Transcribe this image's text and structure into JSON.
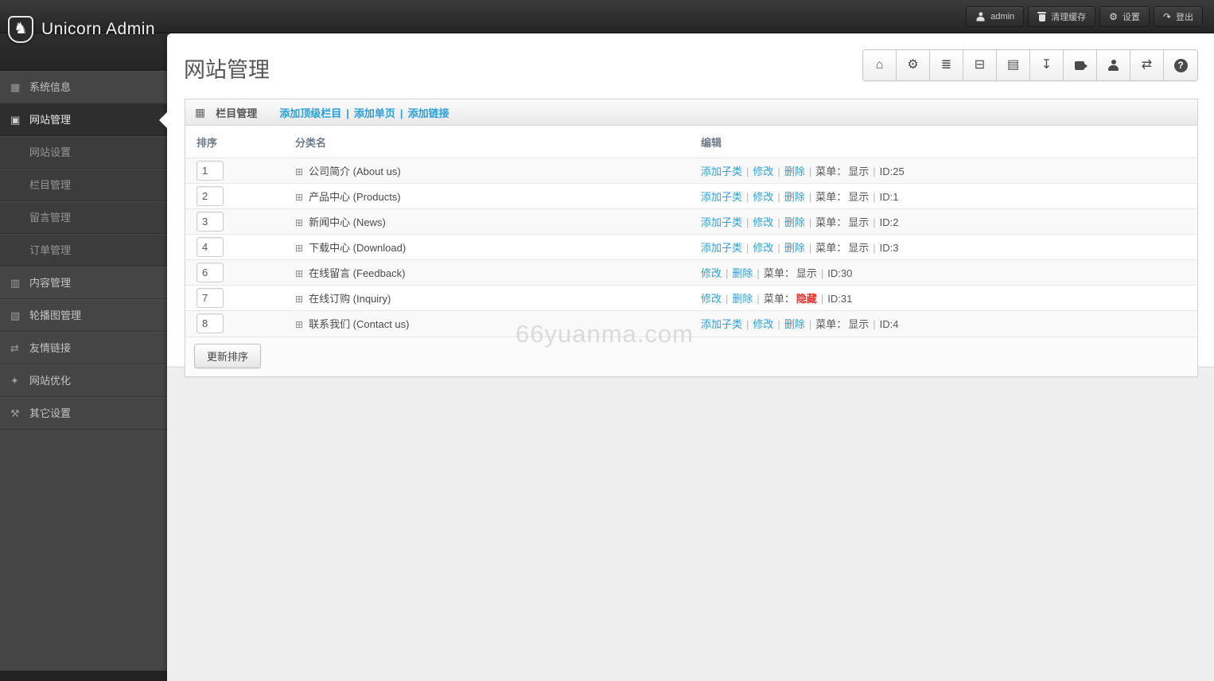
{
  "topbar": {
    "brand": "Unicorn Admin",
    "buttons": [
      {
        "icon": "person",
        "label": "admin"
      },
      {
        "icon": "trash",
        "label": "清理缓存"
      },
      {
        "icon": "gear",
        "label": "设置"
      },
      {
        "icon": "logout",
        "label": "登出"
      }
    ]
  },
  "sidebar": {
    "items": [
      {
        "icon": "grid",
        "label": "系统信息",
        "type": "item"
      },
      {
        "icon": "file",
        "label": "网站管理",
        "type": "active"
      },
      {
        "icon": null,
        "label": "网站设置",
        "type": "sub"
      },
      {
        "icon": null,
        "label": "栏目管理",
        "type": "sub"
      },
      {
        "icon": null,
        "label": "留言管理",
        "type": "sub"
      },
      {
        "icon": null,
        "label": "订单管理",
        "type": "sub"
      },
      {
        "icon": "briefcase",
        "label": "内容管理",
        "type": "item"
      },
      {
        "icon": "picture",
        "label": "轮播图管理",
        "type": "item"
      },
      {
        "icon": "retweet",
        "label": "友情链接",
        "type": "item"
      },
      {
        "icon": "magic",
        "label": "网站优化",
        "type": "item"
      },
      {
        "icon": "wrench",
        "label": "其它设置",
        "type": "item"
      }
    ]
  },
  "page": {
    "title": "网站管理"
  },
  "quick_actions": [
    "home",
    "gear",
    "list",
    "hdd",
    "book",
    "download",
    "video",
    "user",
    "shuffle",
    "help"
  ],
  "widget": {
    "icon": "grid",
    "title": "栏目管理",
    "links": [
      "添加顶级栏目",
      "添加单页",
      "添加链接"
    ],
    "sep": "|"
  },
  "table": {
    "headers": [
      "排序",
      "分类名",
      "编辑"
    ],
    "rows": [
      {
        "sort": "1",
        "name": "公司简介 (About us)",
        "add_child": true,
        "state": "显示",
        "hidden": false,
        "id": "ID:25"
      },
      {
        "sort": "2",
        "name": "产品中心 (Products)",
        "add_child": true,
        "state": "显示",
        "hidden": false,
        "id": "ID:1"
      },
      {
        "sort": "3",
        "name": "新闻中心 (News)",
        "add_child": true,
        "state": "显示",
        "hidden": false,
        "id": "ID:2"
      },
      {
        "sort": "4",
        "name": "下载中心 (Download)",
        "add_child": true,
        "state": "显示",
        "hidden": false,
        "id": "ID:3"
      },
      {
        "sort": "6",
        "name": "在线留言 (Feedback)",
        "add_child": false,
        "state": "显示",
        "hidden": false,
        "id": "ID:30"
      },
      {
        "sort": "7",
        "name": "在线订购 (Inquiry)",
        "add_child": false,
        "state": "隐藏",
        "hidden": true,
        "id": "ID:31"
      },
      {
        "sort": "8",
        "name": "联系我们 (Contact us)",
        "add_child": true,
        "state": "显示",
        "hidden": false,
        "id": "ID:4"
      }
    ]
  },
  "action_labels": {
    "add_child": "添加子类",
    "modify": "修改",
    "delete": "删除",
    "menu": "菜单：",
    "sep": "|"
  },
  "footer": {
    "update_button": "更新排序"
  },
  "watermark": "66yuanma.com",
  "colors": {
    "link_blue": "#2d9fd9",
    "hidden_red": "#e9322d",
    "sidebar_bg": "#454545",
    "topbar_bg": "#2b2b2b"
  }
}
